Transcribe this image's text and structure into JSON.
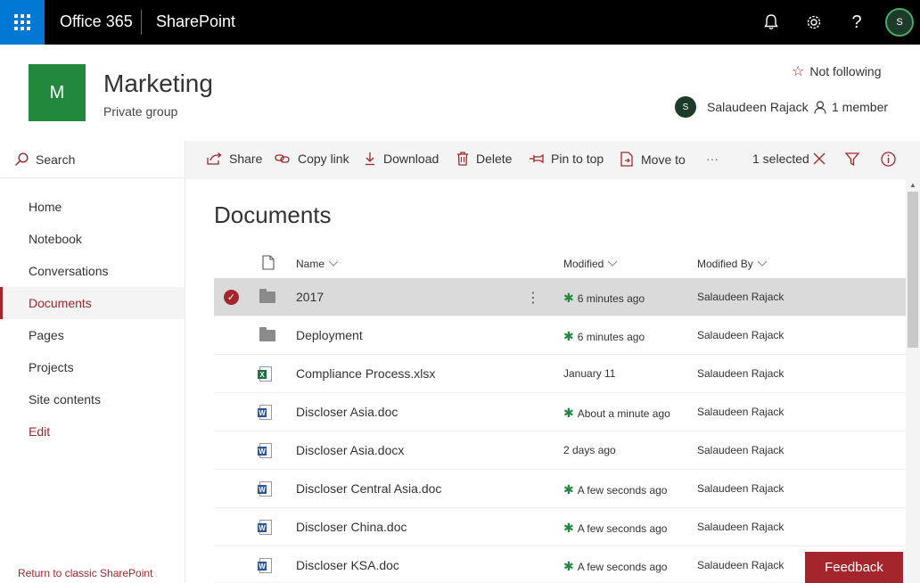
{
  "suitebar": {
    "brand": "Office 365",
    "app": "SharePoint"
  },
  "site": {
    "logo_letter": "M",
    "title": "Marketing",
    "subtitle": "Private group",
    "follow_label": "Not following",
    "owner_name": "Salaudeen Rajack",
    "members_label": "1 member"
  },
  "leftnav": {
    "search_label": "Search",
    "items": [
      {
        "label": "Home"
      },
      {
        "label": "Notebook"
      },
      {
        "label": "Conversations"
      },
      {
        "label": "Documents"
      },
      {
        "label": "Pages"
      },
      {
        "label": "Projects"
      },
      {
        "label": "Site contents"
      },
      {
        "label": "Edit"
      }
    ],
    "classic_link": "Return to classic SharePoint"
  },
  "commandbar": {
    "share": "Share",
    "copy_link": "Copy link",
    "download": "Download",
    "delete": "Delete",
    "pin": "Pin to top",
    "move": "Move to",
    "more": "···",
    "selected": "1 selected"
  },
  "library": {
    "title": "Documents",
    "columns": {
      "name": "Name",
      "modified": "Modified",
      "modified_by": "Modified By"
    },
    "rows": [
      {
        "name": "2017",
        "type": "folder",
        "modified": "6 minutes ago",
        "new": true,
        "by": "Salaudeen Rajack",
        "selected": true
      },
      {
        "name": "Deployment",
        "type": "folder",
        "modified": "6 minutes ago",
        "new": true,
        "by": "Salaudeen Rajack"
      },
      {
        "name": "Compliance Process.xlsx",
        "type": "xlsx",
        "modified": "January 11",
        "new": false,
        "by": "Salaudeen Rajack"
      },
      {
        "name": "Discloser Asia.doc",
        "type": "doc",
        "modified": "About a minute ago",
        "new": true,
        "by": "Salaudeen Rajack"
      },
      {
        "name": "Discloser Asia.docx",
        "type": "doc",
        "modified": "2 days ago",
        "new": false,
        "by": "Salaudeen Rajack"
      },
      {
        "name": "Discloser Central Asia.doc",
        "type": "doc",
        "modified": "A few seconds ago",
        "new": true,
        "by": "Salaudeen Rajack"
      },
      {
        "name": "Discloser China.doc",
        "type": "doc",
        "modified": "A few seconds ago",
        "new": true,
        "by": "Salaudeen Rajack"
      },
      {
        "name": "Discloser KSA.doc",
        "type": "doc",
        "modified": "A few seconds ago",
        "new": true,
        "by": "Salaudeen Rajack"
      }
    ]
  },
  "feedback_label": "Feedback",
  "colors": {
    "accent": "#a4262c",
    "suitebar": "#000000",
    "waffle": "#0078d4",
    "site_logo": "#21883d"
  }
}
